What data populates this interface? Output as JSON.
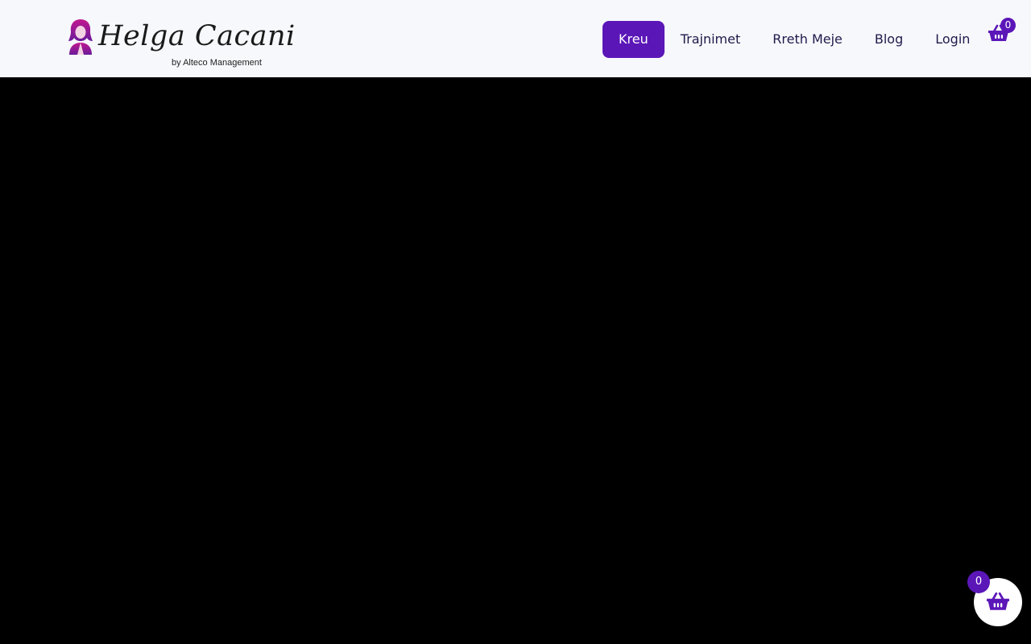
{
  "brand": {
    "name": "Helga Cacani",
    "tagline": "by Alteco Management",
    "logo_icon": "woman-portrait-icon"
  },
  "nav": {
    "items": [
      {
        "label": "Kreu",
        "active": true
      },
      {
        "label": "Trajnimet",
        "active": false
      },
      {
        "label": "Rreth Meje",
        "active": false
      },
      {
        "label": "Blog",
        "active": false
      },
      {
        "label": "Login",
        "active": false
      }
    ]
  },
  "cart": {
    "icon": "shopping-basket-icon",
    "count": "0"
  },
  "floating_cart": {
    "icon": "shopping-basket-icon",
    "count": "0"
  },
  "colors": {
    "accent": "#5b16b8",
    "header_bg": "#f7f8fc",
    "nav_text": "#1e1b4b",
    "hero_bg": "#000000"
  }
}
